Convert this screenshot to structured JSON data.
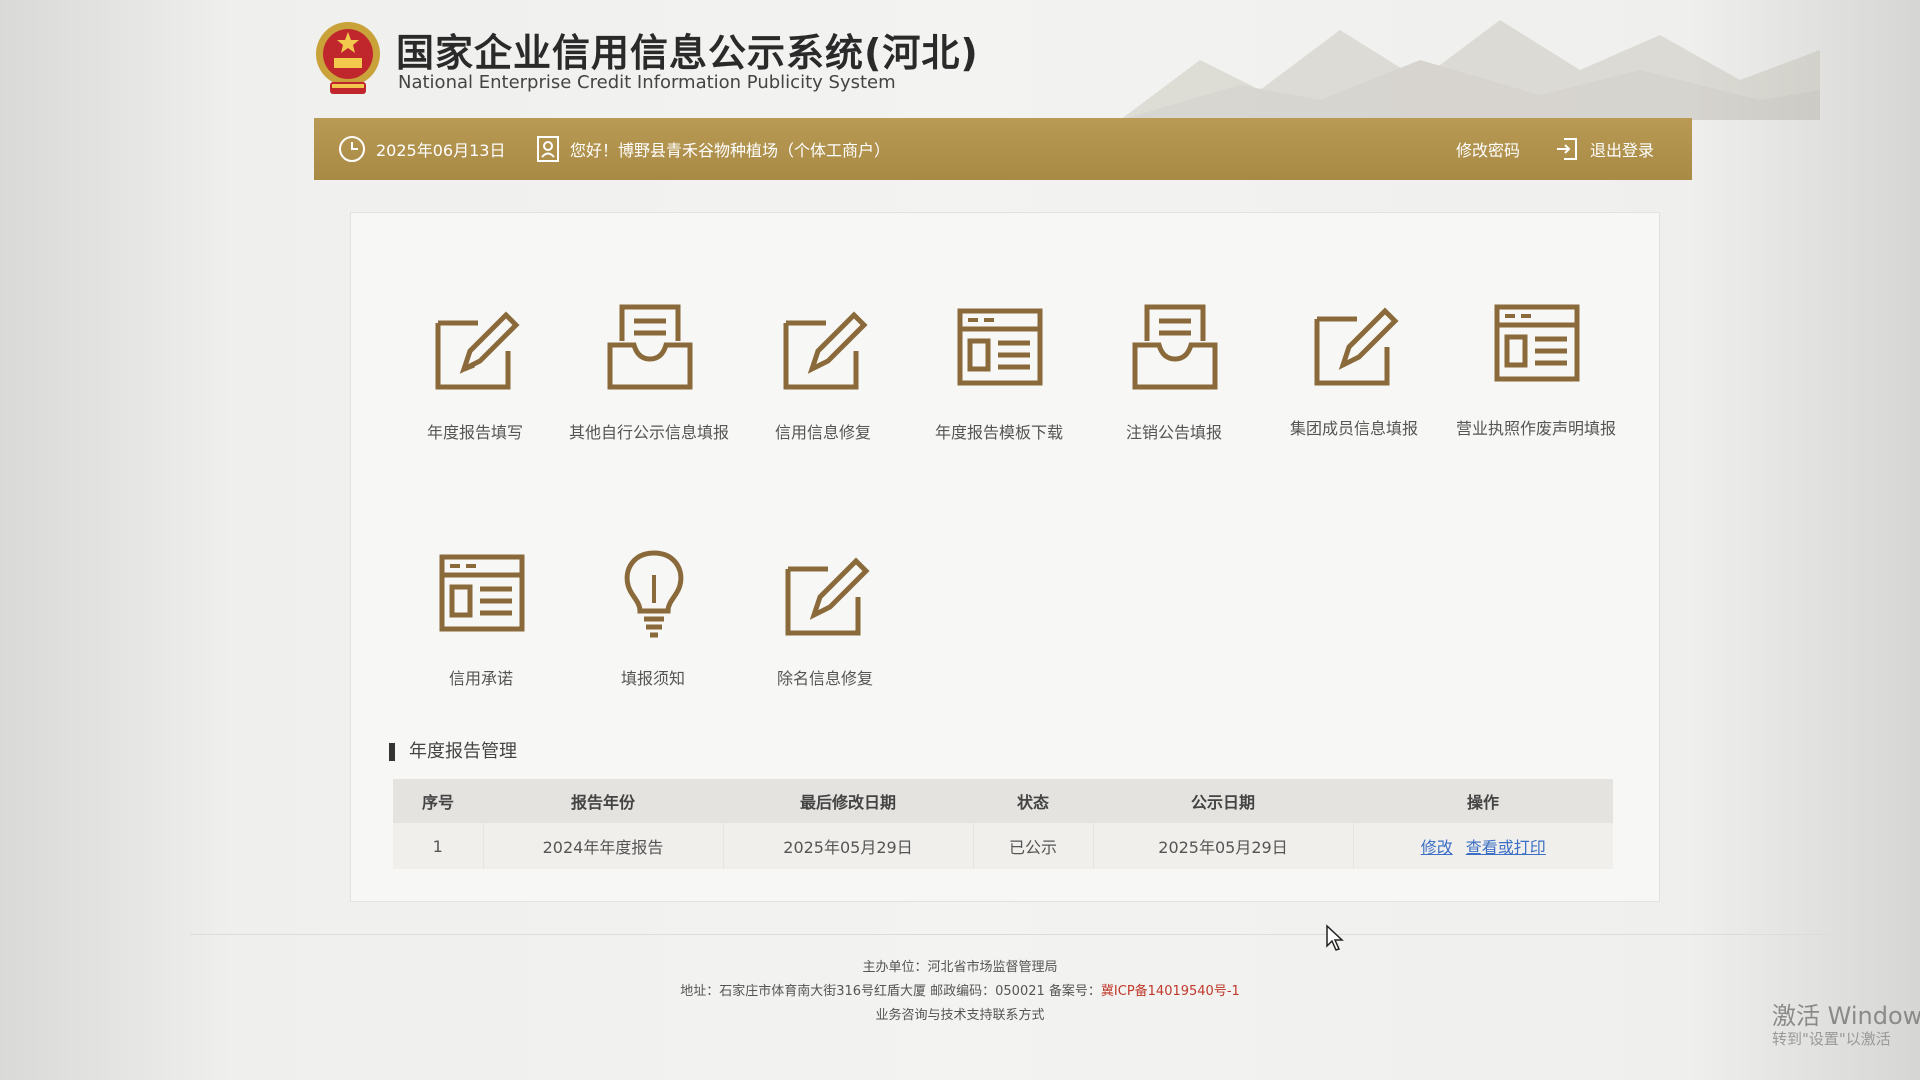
{
  "header": {
    "title_cn": "国家企业信用信息公示系统(河北)",
    "title_en": "National Enterprise Credit Information Publicity System"
  },
  "topbar": {
    "date": "2025年06月13日",
    "greeting": "您好！博野县青禾谷物种植场（个体工商户）",
    "change_password": "修改密码",
    "logout": "退出登录"
  },
  "tiles": [
    {
      "label": "年度报告填写",
      "icon": "edit-icon"
    },
    {
      "label": "其他自行公示信息填报",
      "icon": "inbox-icon"
    },
    {
      "label": "信用信息修复",
      "icon": "edit-icon"
    },
    {
      "label": "年度报告模板下载",
      "icon": "document-icon"
    },
    {
      "label": "注销公告填报",
      "icon": "inbox-icon"
    },
    {
      "label": "集团成员信息填报",
      "icon": "edit-icon"
    },
    {
      "label": "营业执照作废声明填报",
      "icon": "document-icon"
    },
    {
      "label": "信用承诺",
      "icon": "document-icon"
    },
    {
      "label": "填报须知",
      "icon": "lightbulb-icon"
    },
    {
      "label": "除名信息修复",
      "icon": "edit-icon"
    }
  ],
  "report_section": {
    "title": "年度报告管理",
    "columns": [
      "序号",
      "报告年份",
      "最后修改日期",
      "状态",
      "公示日期",
      "操作"
    ],
    "rows": [
      {
        "index": "1",
        "year": "2024年年度报告",
        "modified": "2025年05月29日",
        "status": "已公示",
        "published": "2025年05月29日",
        "action_edit": "修改",
        "action_view": "查看或打印"
      }
    ]
  },
  "footer": {
    "sponsor": "主办单位：河北省市场监督管理局",
    "address": "地址：石家庄市体育南大街316号红盾大厦 邮政编码：050021 备案号：",
    "icp": "冀ICP备14019540号-1",
    "contact": "业务咨询与技术支持联系方式"
  },
  "os_watermark": {
    "line1": "激活 Window",
    "line2": "转到\"设置\"以激活"
  },
  "colors": {
    "gold_bar": "#b99a55",
    "icon_stroke": "#8a6a3a",
    "link": "#3c6fc6",
    "icp_red": "#c0392b"
  }
}
